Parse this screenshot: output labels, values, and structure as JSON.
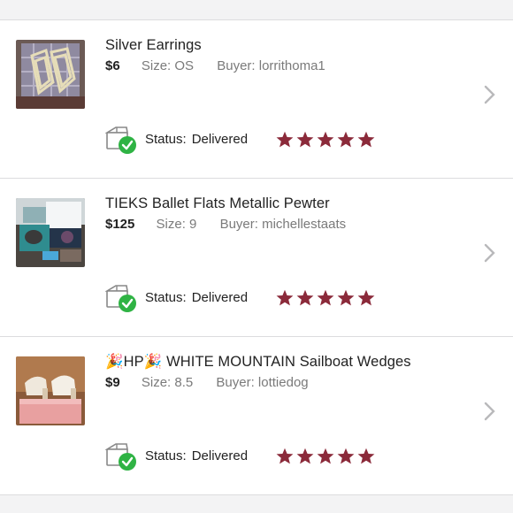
{
  "orders": [
    {
      "title": "Silver Earrings",
      "price": "$6",
      "size": "Size: OS",
      "buyer": "Buyer: lorrithoma1",
      "status_label": "Status:",
      "status_value": "Delivered",
      "rating": 5
    },
    {
      "title": "TIEKS Ballet Flats Metallic Pewter",
      "price": "$125",
      "size": "Size: 9",
      "buyer": "Buyer: michellestaats",
      "status_label": "Status:",
      "status_value": "Delivered",
      "rating": 5
    },
    {
      "title": "🎉HP🎉 WHITE MOUNTAIN Sailboat Wedges",
      "price": "$9",
      "size": "Size: 8.5",
      "buyer": "Buyer: lottiedog",
      "status_label": "Status:",
      "status_value": "Delivered",
      "rating": 5
    }
  ],
  "colors": {
    "star": "#8b2a3a",
    "check": "#2fb344",
    "chevron": "#b9b9bb"
  },
  "icons": {
    "status": "package-delivered-icon",
    "nav": "chevron-right-icon",
    "rating": "star-icon"
  }
}
